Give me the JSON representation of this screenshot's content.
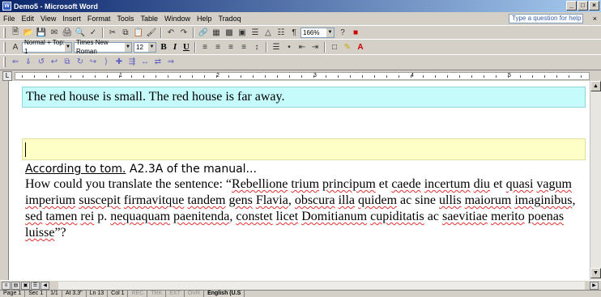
{
  "window": {
    "title": "Demo5 - Microsoft Word",
    "min": "_",
    "max": "□",
    "close": "×"
  },
  "menu": {
    "items": [
      "File",
      "Edit",
      "View",
      "Insert",
      "Format",
      "Tools",
      "Table",
      "Window",
      "Help",
      "Tradoq"
    ],
    "ask_placeholder": "Type a question for help",
    "close": "×"
  },
  "toolbar1": {
    "zoom": "166%"
  },
  "toolbar2": {
    "style": "Normal + Top: 1",
    "font": "Times New Roman",
    "size": "12"
  },
  "ruler": {
    "numbers": [
      "1",
      "2",
      "3",
      "4",
      "5"
    ]
  },
  "document": {
    "para1": "The red house is small. The red house is far away.",
    "line3_link": "According to tom.",
    "line3_rest": " A2.3A of the manual...",
    "body": [
      {
        "t": "How could you translate the sentence: “",
        "s": false
      },
      {
        "t": "Rebellione",
        "s": true
      },
      {
        "t": " ",
        "s": false
      },
      {
        "t": "trium",
        "s": true
      },
      {
        "t": " ",
        "s": false
      },
      {
        "t": "principum",
        "s": true
      },
      {
        "t": " et ",
        "s": false
      },
      {
        "t": "caede",
        "s": true
      },
      {
        "t": " ",
        "s": false
      },
      {
        "t": "incertum",
        "s": true
      },
      {
        "t": " ",
        "s": false
      },
      {
        "t": "diu",
        "s": true
      },
      {
        "t": " et ",
        "s": false
      },
      {
        "t": "quasi",
        "s": true
      },
      {
        "t": " ",
        "s": false
      },
      {
        "t": "vagum",
        "s": true
      },
      {
        "t": " ",
        "s": false
      },
      {
        "t": "imperium",
        "s": true
      },
      {
        "t": " ",
        "s": false
      },
      {
        "t": "suscepit",
        "s": true
      },
      {
        "t": " ",
        "s": false
      },
      {
        "t": "firmavitque",
        "s": true
      },
      {
        "t": " ",
        "s": false
      },
      {
        "t": "tandem",
        "s": true
      },
      {
        "t": " ",
        "s": false
      },
      {
        "t": "gens",
        "s": true
      },
      {
        "t": " ",
        "s": false
      },
      {
        "t": "Flavia",
        "s": true
      },
      {
        "t": ", ",
        "s": false
      },
      {
        "t": "obscura",
        "s": true
      },
      {
        "t": " ",
        "s": false
      },
      {
        "t": "illa",
        "s": true
      },
      {
        "t": " ",
        "s": false
      },
      {
        "t": "quidem",
        "s": true
      },
      {
        "t": " ac sine ",
        "s": false
      },
      {
        "t": "ullis",
        "s": true
      },
      {
        "t": " ",
        "s": false
      },
      {
        "t": "maiorum",
        "s": true
      },
      {
        "t": " ",
        "s": false
      },
      {
        "t": "imaginibus",
        "s": true
      },
      {
        "t": ", ",
        "s": false
      },
      {
        "t": "sed",
        "s": true
      },
      {
        "t": " ",
        "s": false
      },
      {
        "t": "tamen",
        "s": true
      },
      {
        "t": " ",
        "s": false
      },
      {
        "t": "rei",
        "s": true
      },
      {
        "t": " p. ",
        "s": false
      },
      {
        "t": "nequaquam",
        "s": true
      },
      {
        "t": " ",
        "s": false
      },
      {
        "t": "paenitenda",
        "s": true
      },
      {
        "t": ", ",
        "s": false
      },
      {
        "t": "constet",
        "s": true
      },
      {
        "t": " ",
        "s": false
      },
      {
        "t": "licet",
        "s": true
      },
      {
        "t": " ",
        "s": false
      },
      {
        "t": "Domitianum",
        "s": true
      },
      {
        "t": " ",
        "s": false
      },
      {
        "t": "cupiditatis",
        "s": true
      },
      {
        "t": " ac ",
        "s": false
      },
      {
        "t": "saevitiae",
        "s": true
      },
      {
        "t": " ",
        "s": false
      },
      {
        "t": "merito",
        "s": true
      },
      {
        "t": " ",
        "s": false
      },
      {
        "t": "poenas",
        "s": true
      },
      {
        "t": " ",
        "s": false
      },
      {
        "t": "luisse",
        "s": true
      },
      {
        "t": "”?",
        "s": false
      }
    ]
  },
  "status": [
    {
      "t": "Page 1",
      "dim": false
    },
    {
      "t": "Sec 1",
      "dim": false
    },
    {
      "t": "1/1",
      "dim": false
    },
    {
      "t": "At 3.3\"",
      "dim": false
    },
    {
      "t": "Ln 13",
      "dim": false
    },
    {
      "t": "Col 1",
      "dim": false
    },
    {
      "t": "REC",
      "dim": true
    },
    {
      "t": "TRK",
      "dim": true
    },
    {
      "t": "EXT",
      "dim": true
    },
    {
      "t": "OVR",
      "dim": true
    },
    {
      "t": "English (U.S",
      "dim": false,
      "lang": true
    }
  ]
}
